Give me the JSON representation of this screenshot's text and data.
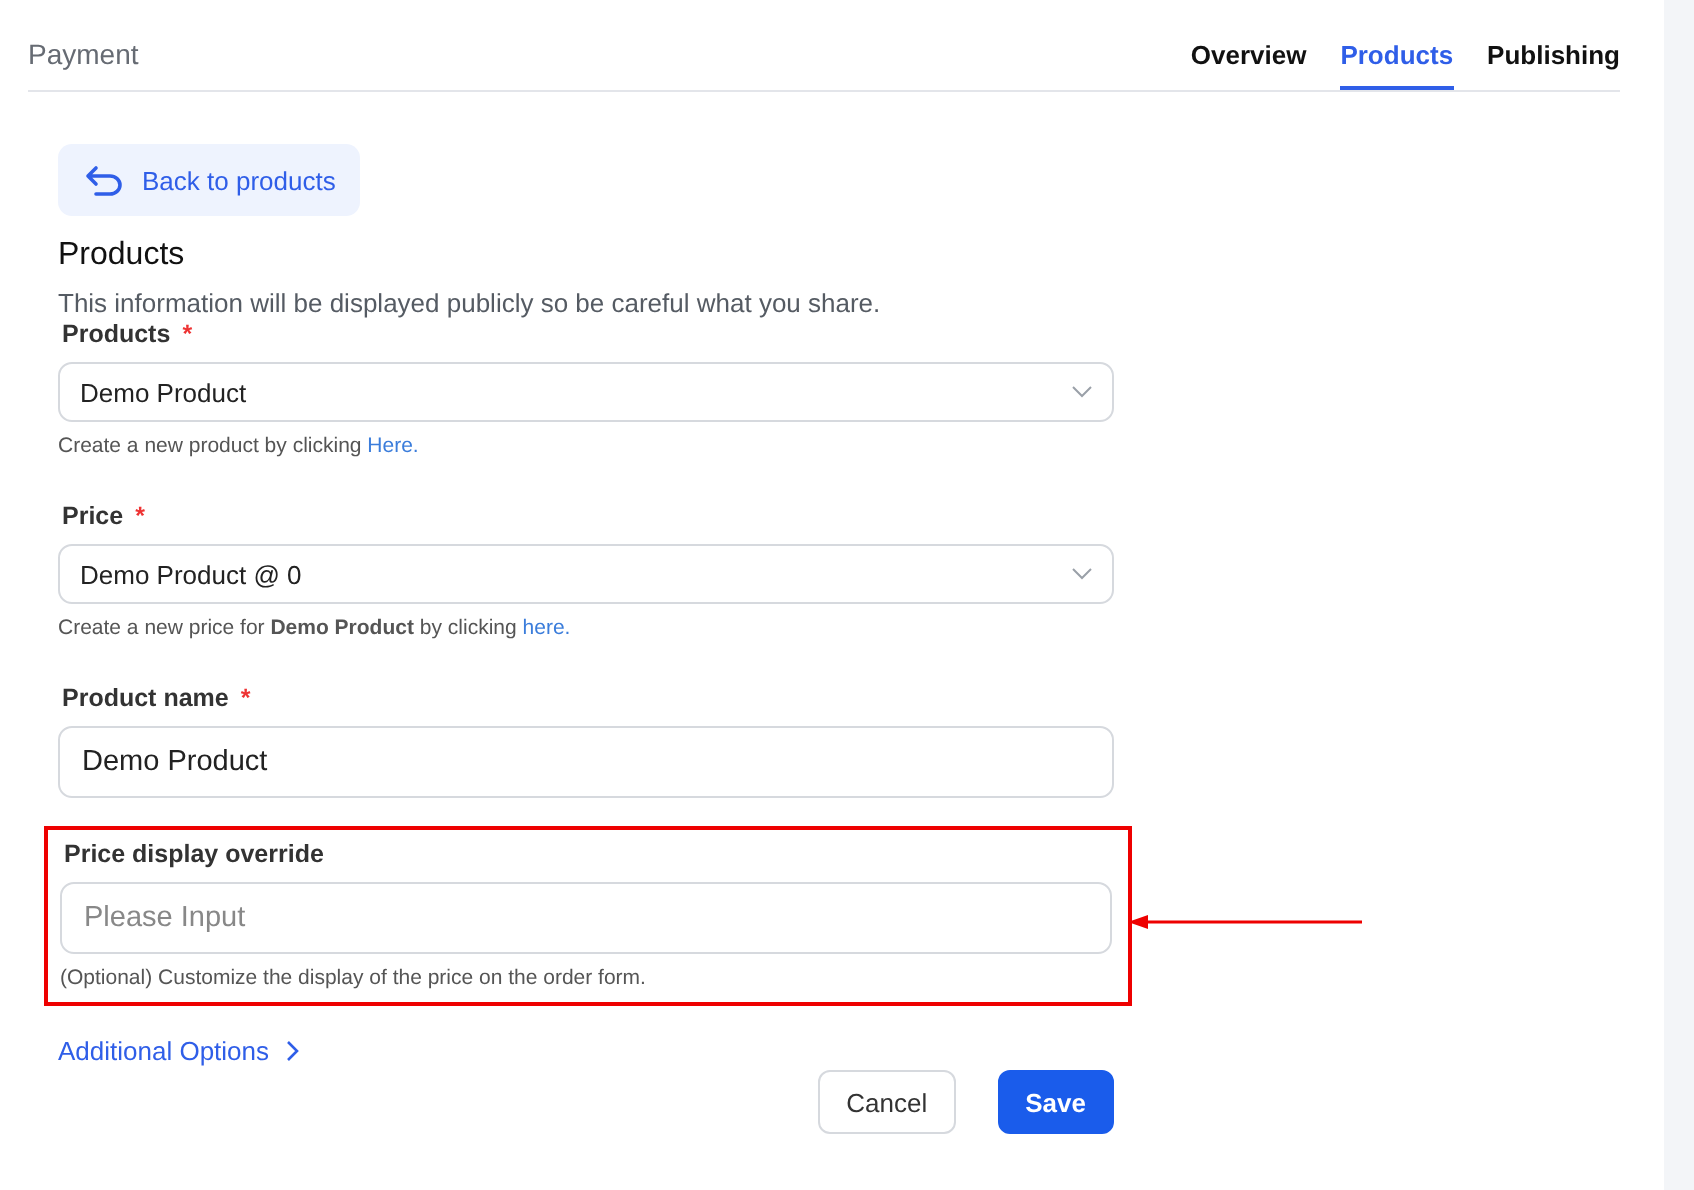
{
  "header": {
    "title": "Payment",
    "tabs": [
      {
        "label": "Overview",
        "selected": false
      },
      {
        "label": "Products",
        "selected": true
      },
      {
        "label": "Publishing",
        "selected": false
      }
    ]
  },
  "back_button": "Back to products",
  "section": {
    "title": "Products",
    "description": "This information will be displayed publicly so be careful what you share."
  },
  "fields": [
    {
      "kind": "select",
      "label": "Products",
      "marker": "*",
      "value": "Demo Product",
      "help": {
        "text": "Create a new product by clicking ",
        "link": "Here."
      }
    },
    {
      "kind": "select",
      "label": "Price",
      "marker": "*",
      "value": "Demo Product @ 0",
      "help": {
        "text": "Create a new price for **Demo Product** by clicking ",
        "link": "here."
      }
    },
    {
      "kind": "input",
      "label": "Product name",
      "marker": "*",
      "value": "Demo Product"
    },
    {
      "kind": "input",
      "label": "Price display override",
      "placeholder": "Please Input",
      "highlighted": true,
      "help": {
        "text": "(Optional) Customize the display of the price on the order form."
      }
    }
  ],
  "additional_options": "Additional Options",
  "buttons": [
    {
      "label": "Cancel",
      "kind": "secondary"
    },
    {
      "label": "Save",
      "kind": "primary"
    }
  ]
}
